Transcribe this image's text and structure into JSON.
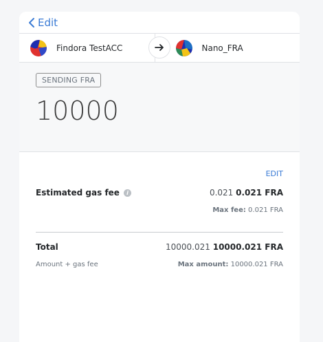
{
  "header": {
    "back_label": "Edit"
  },
  "accounts": {
    "from_name": "Findora TestACC",
    "to_name": "Nano_FRA"
  },
  "send": {
    "chip_label": "SENDING FRA",
    "amount": "10000"
  },
  "details": {
    "edit_label": "EDIT",
    "gas_label": "Estimated gas fee",
    "gas_value_light": "0.021",
    "gas_value_bold": "0.021 FRA",
    "max_fee_label": "Max fee:",
    "max_fee_value": "0.021 FRA",
    "total_label": "Total",
    "total_value_light": "10000.021",
    "total_value_bold": "10000.021 FRA",
    "total_sub_label": "Amount + gas fee",
    "max_amount_label": "Max amount:",
    "max_amount_value": "10000.021 FRA"
  },
  "colors": {
    "accent": "#3a7bd5",
    "panel_bg": "#f7f8f9"
  },
  "icons": {
    "back": "chevron-left-icon",
    "transfer": "arrow-right-icon",
    "info": "info-icon"
  }
}
